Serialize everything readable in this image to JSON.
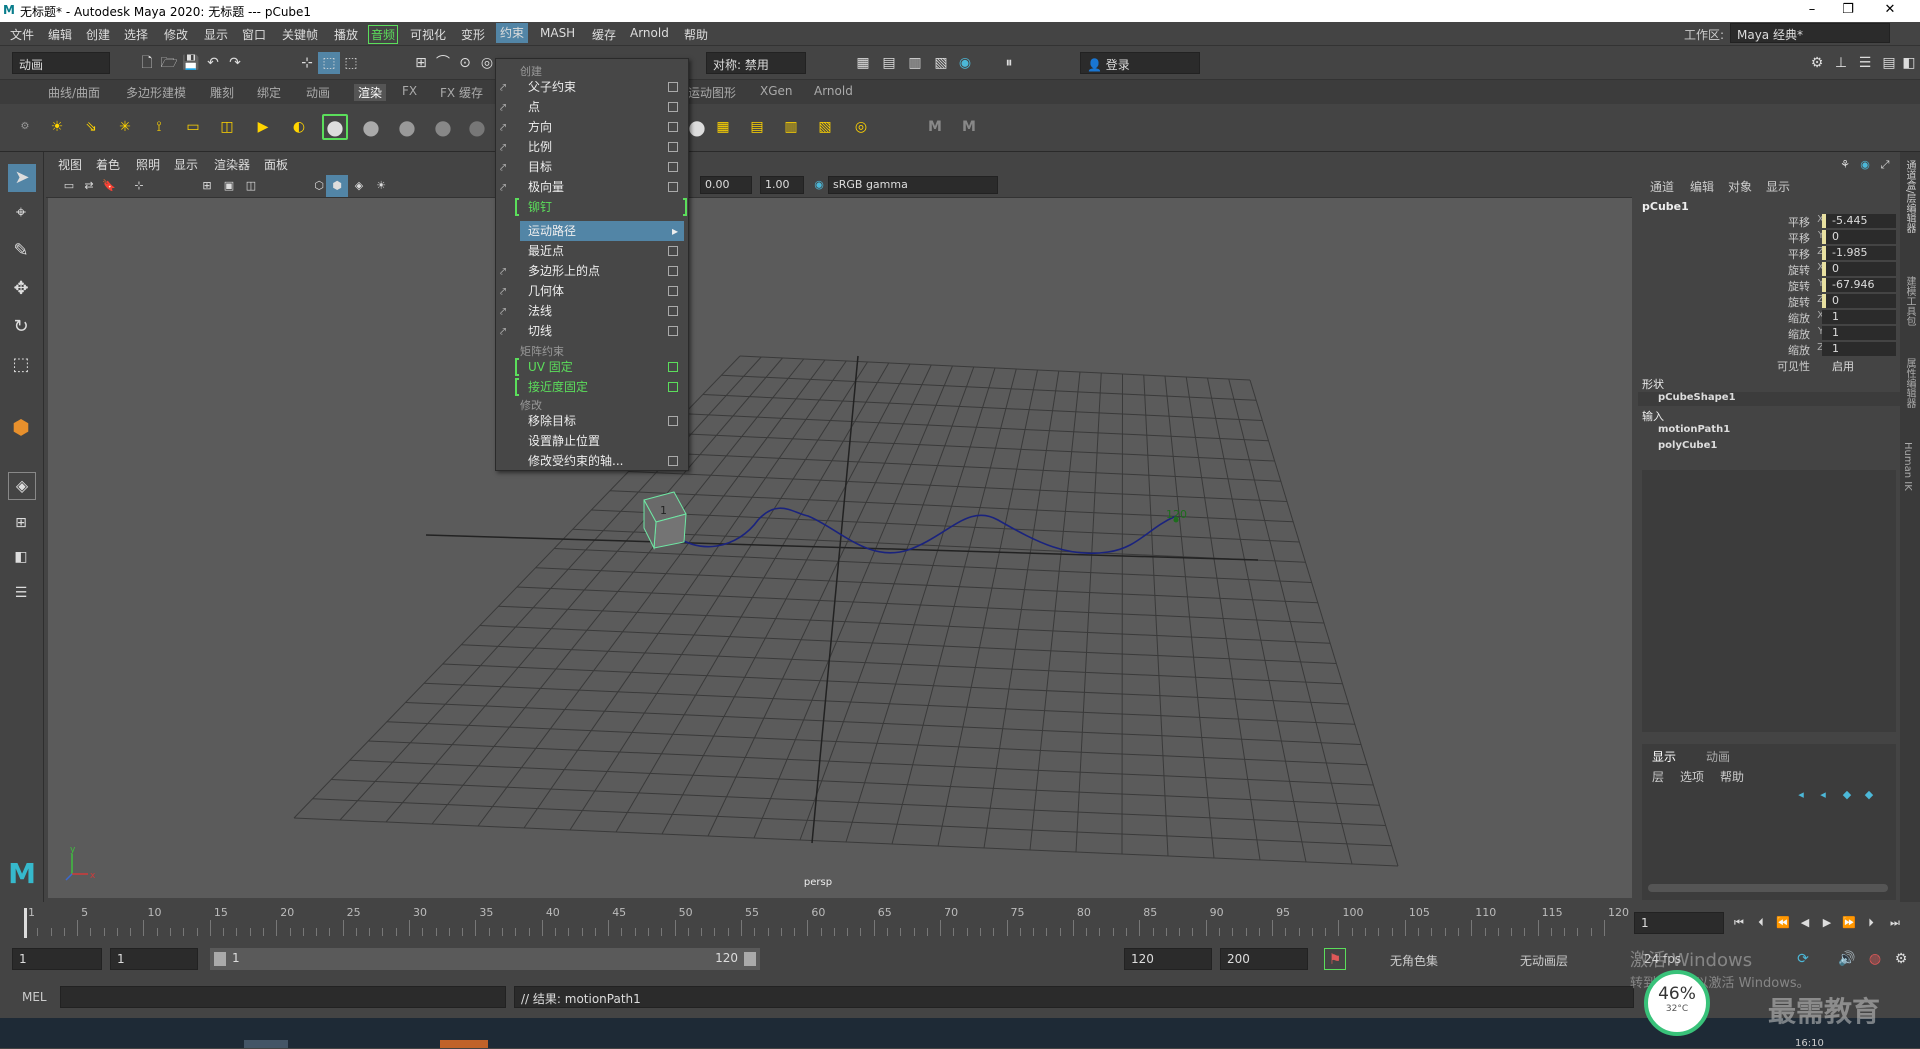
{
  "window": {
    "title": "无标题* - Autodesk Maya 2020: 无标题   ---   pCube1",
    "min": "–",
    "max": "❐",
    "close": "✕"
  },
  "menubar": {
    "items": [
      "文件",
      "编辑",
      "创建",
      "选择",
      "修改",
      "显示",
      "窗口",
      "关键帧",
      "播放",
      "音频",
      "可视化",
      "变形",
      "约束",
      "MASH",
      "缓存",
      "Arnold",
      "帮助"
    ],
    "workspace_label": "工作区:",
    "workspace_value": "Maya 经典*"
  },
  "toolbar": {
    "mode": "动画",
    "symmetry": "对称: 禁用",
    "login": "登录"
  },
  "shelf_tabs": [
    "曲线/曲面",
    "多边形建模",
    "雕刻",
    "绑定",
    "动画",
    "渲染",
    "FX",
    "FX 缓存",
    "运动图形",
    "XGen",
    "Arnold"
  ],
  "viewport": {
    "menus": [
      "视图",
      "着色",
      "照明",
      "显示",
      "渲染器",
      "面板"
    ],
    "exposure": "0.00",
    "gamma": "1.00",
    "colorspace": "sRGB gamma",
    "camera_label": "persp",
    "frame_marker_1": "1",
    "frame_marker_120": "120",
    "axis_y": "y",
    "axis_x": "x"
  },
  "constrain_menu": {
    "section_create": "创建",
    "items_a": [
      "父子约束",
      "点",
      "方向",
      "比例",
      "目标",
      "极向量"
    ],
    "rivet": "铆钉",
    "motion_path": "运动路径",
    "items_b": [
      "最近点",
      "多边形上的点",
      "几何体",
      "法线",
      "切线"
    ],
    "section_matrix": "矩阵约束",
    "uv_pin": "UV 固定",
    "proximity_pin": "接近度固定",
    "section_modify": "修改",
    "remove_target": "移除目标",
    "set_rest": "设置静止位置",
    "modify_axis": "修改受约束的轴..."
  },
  "channel_box": {
    "menus": [
      "通道",
      "编辑",
      "对象",
      "显示"
    ],
    "object": "pCube1",
    "channels": [
      {
        "label": "平移",
        "axis": "X",
        "value": "-5.445"
      },
      {
        "label": "平移",
        "axis": "Y",
        "value": "0"
      },
      {
        "label": "平移",
        "axis": "Z",
        "value": "-1.985"
      },
      {
        "label": "旋转",
        "axis": "X",
        "value": "0"
      },
      {
        "label": "旋转",
        "axis": "Y",
        "value": "-67.946"
      },
      {
        "label": "旋转",
        "axis": "Z",
        "value": "0"
      },
      {
        "label": "缩放",
        "axis": "X",
        "value": "1"
      },
      {
        "label": "缩放",
        "axis": "Y",
        "value": "1"
      },
      {
        "label": "缩放",
        "axis": "Z",
        "value": "1"
      },
      {
        "label": "可见性",
        "axis": "",
        "value": "启用"
      }
    ],
    "shapes_header": "形状",
    "shape": "pCubeShape1",
    "inputs_header": "输入",
    "inputs": [
      "motionPath1",
      "polyCube1"
    ],
    "layer_tabs": [
      "显示",
      "动画"
    ],
    "layer_menus": [
      "层",
      "选项",
      "帮助"
    ]
  },
  "side_tabs": [
    "通道盒/层编辑器",
    "建模工具包",
    "属性编辑器",
    "Human IK"
  ],
  "timeline": {
    "ticks": [
      "1",
      "5",
      "10",
      "15",
      "20",
      "25",
      "30",
      "35",
      "40",
      "45",
      "50",
      "55",
      "60",
      "65",
      "70",
      "75",
      "80",
      "85",
      "90",
      "95",
      "100",
      "105",
      "110",
      "115",
      "120"
    ],
    "current_frame": "1"
  },
  "range": {
    "start": "1",
    "start2": "1",
    "slider_start": "1",
    "slider_end": "120",
    "end": "120",
    "end2": "200",
    "char_set": "无角色集",
    "anim_layer": "无动画层",
    "fps": "24 fps"
  },
  "command": {
    "lang": "MEL",
    "result": "// 结果: motionPath1"
  },
  "overlay": {
    "activate_1": "激活 Windows",
    "activate_2": "转到“设置”以激活 Windows。",
    "watermark": "最需教育",
    "cpu_pct": "46%",
    "cpu_temp": "32°C",
    "clock": "16:10"
  }
}
